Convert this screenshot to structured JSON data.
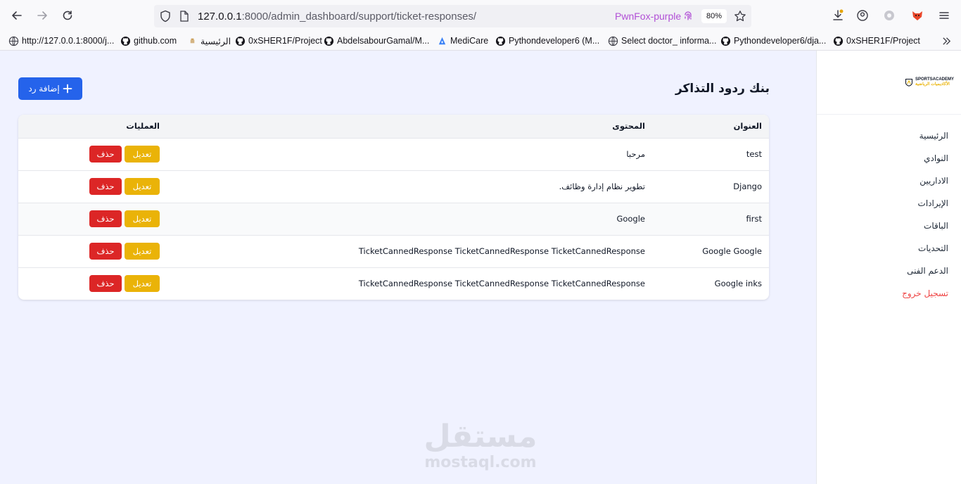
{
  "browser": {
    "url_host": "127.0.0.1",
    "url_rest": ":8000/admin_dashboard/support/ticket-responses/",
    "container": "PwnFox-purple",
    "zoom": "80%"
  },
  "bookmarks": [
    {
      "label": "http://127.0.0.1:8000/j...",
      "icon": "globe-icon"
    },
    {
      "label": "github.com",
      "icon": "github-icon"
    },
    {
      "label": "الرئيسية",
      "icon": "site-icon"
    },
    {
      "label": "0xSHER1F/Project",
      "icon": "github-icon"
    },
    {
      "label": "AbdelsabourGamal/M...",
      "icon": "github-icon"
    },
    {
      "label": "MediCare",
      "icon": "medicare-icon"
    },
    {
      "label": "Pythondeveloper6 (M...",
      "icon": "github-icon"
    },
    {
      "label": "Select doctor_ informa...",
      "icon": "globe-icon"
    },
    {
      "label": "Pythondeveloper6/dja...",
      "icon": "github-icon"
    },
    {
      "label": "0xSHER1F/Project",
      "icon": "github-icon"
    }
  ],
  "sidebar": {
    "logo_line1": "SPORTSACADEMY",
    "logo_line2": "الأكاديميات الرياضية",
    "items": [
      {
        "label": "الرئيسية"
      },
      {
        "label": "النوادي"
      },
      {
        "label": "الاداريين"
      },
      {
        "label": "الإيرادات"
      },
      {
        "label": "الباقات"
      },
      {
        "label": "التحديات"
      },
      {
        "label": "الدعم الفنى"
      },
      {
        "label": "تسجيل خروج"
      }
    ]
  },
  "main": {
    "title": "بنك ردود التذاكر",
    "add_label": "إضافة رد"
  },
  "table": {
    "headers": {
      "title": "العنوان",
      "content": "المحتوى",
      "ops": "العمليات"
    },
    "edit_label": "تعديل",
    "delete_label": "حذف",
    "rows": [
      {
        "title": "test",
        "content": "مرحبا"
      },
      {
        "title": "Django",
        "content": "تطوير نظام إدارة وظائف."
      },
      {
        "title": "first",
        "content": "Google"
      },
      {
        "title": "Google Google",
        "content": "TicketCannedResponse TicketCannedResponse TicketCannedResponse"
      },
      {
        "title": "Google inks",
        "content": "TicketCannedResponse TicketCannedResponse TicketCannedResponse"
      }
    ]
  },
  "watermark": {
    "arabic": "مستقل",
    "latin": "mostaql.com"
  },
  "colors": {
    "primary": "#2563eb",
    "edit": "#eab308",
    "delete": "#dc2626",
    "logout": "#ef4444",
    "page_bg": "#f0f2ff"
  }
}
